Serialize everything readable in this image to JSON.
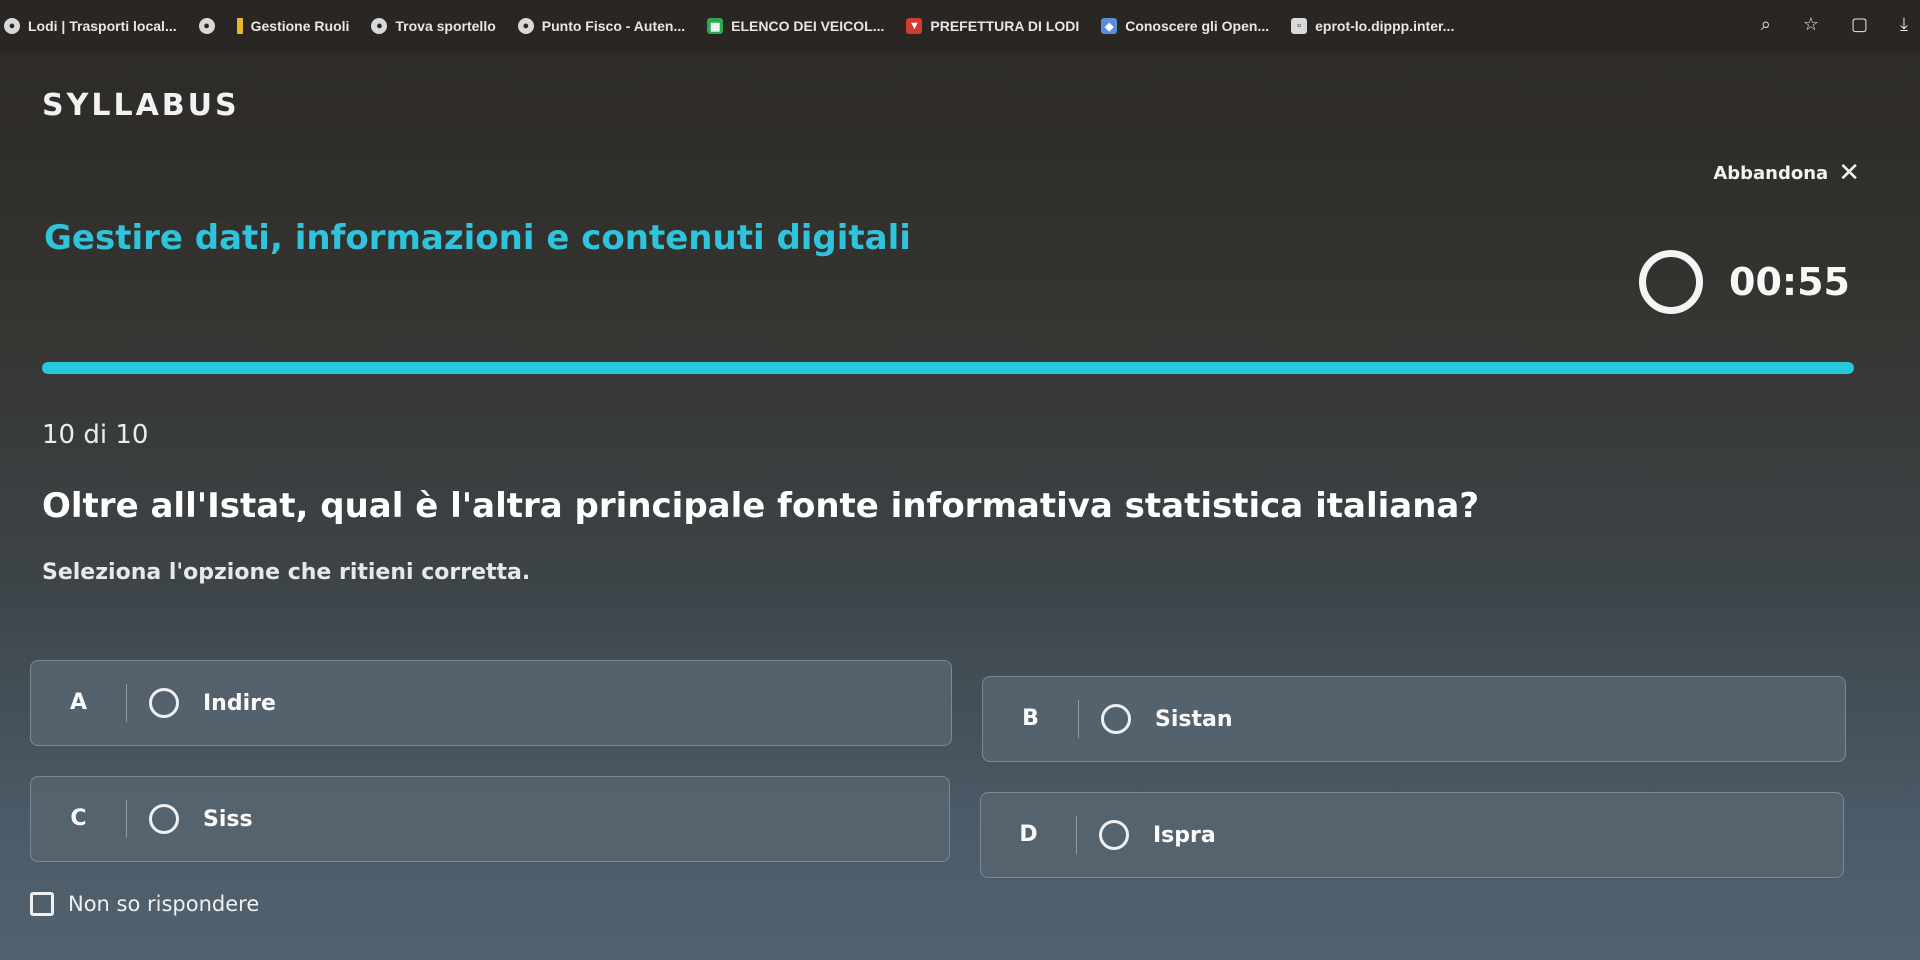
{
  "bookmarks": [
    {
      "label": "Lodi | Trasporti local...",
      "icon": "globe-icon"
    },
    {
      "label": "",
      "icon": "globe-icon"
    },
    {
      "label": "Gestione Ruoli",
      "icon": "bookmark-icon"
    },
    {
      "label": "Trova sportello",
      "icon": "globe-icon"
    },
    {
      "label": "Punto Fisco - Auten...",
      "icon": "globe-icon"
    },
    {
      "label": "ELENCO DEI VEICOL...",
      "icon": "sheet-icon"
    },
    {
      "label": "PREFETTURA DI LODI",
      "icon": "shield-icon"
    },
    {
      "label": "Conoscere gli Open...",
      "icon": "site-icon"
    },
    {
      "label": "eprot-lo.dippp.inter...",
      "icon": "page-icon"
    }
  ],
  "browser_tools": {
    "zoom_icon": "zoom-icon",
    "star_icon": "star-icon",
    "extension_icon": "extension-icon",
    "download_icon": "download-icon"
  },
  "app": {
    "logo": "SYLLABUS",
    "abandon_label": "Abbandona"
  },
  "quiz": {
    "title": "Gestire dati, informazioni e contenuti digitali",
    "timer": "00:55",
    "progress_fraction": 1.0,
    "counter": "10 di 10",
    "question": "Oltre all'Istat, qual è l'altra principale fonte informativa statistica italiana?",
    "instruction": "Seleziona l'opzione che ritieni corretta.",
    "options": [
      {
        "letter": "A",
        "label": "Indire"
      },
      {
        "letter": "B",
        "label": "Sistan"
      },
      {
        "letter": "C",
        "label": "Siss"
      },
      {
        "letter": "D",
        "label": "Ispra"
      }
    ],
    "dont_know_label": "Non so rispondere"
  },
  "colors": {
    "accent": "#27c8dc",
    "title": "#2fc4dc"
  }
}
